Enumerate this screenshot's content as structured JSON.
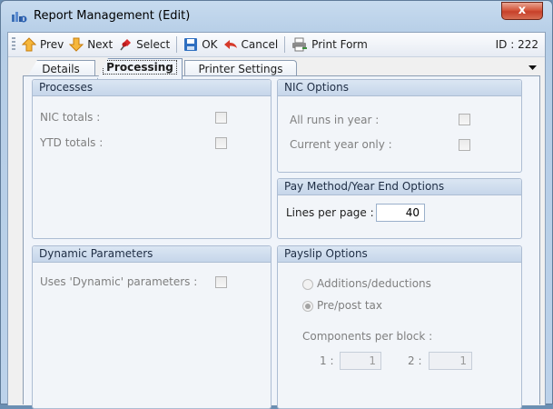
{
  "window": {
    "title": "Report Management (Edit)",
    "close_glyph": "x"
  },
  "toolbar": {
    "prev": "Prev",
    "next": "Next",
    "select": "Select",
    "ok": "OK",
    "cancel": "Cancel",
    "print_form": "Print Form",
    "record_id": "ID : 222"
  },
  "tabs": [
    {
      "label": "Details",
      "active": false
    },
    {
      "label": "Processing",
      "active": true
    },
    {
      "label": "Printer Settings",
      "active": false
    }
  ],
  "processes": {
    "title": "Processes",
    "nic_totals": {
      "label": "NIC totals :",
      "checked": false
    },
    "ytd_totals": {
      "label": "YTD totals :",
      "checked": false
    }
  },
  "nic_options": {
    "title": "NIC Options",
    "all_runs": {
      "label": "All runs in year :",
      "checked": false
    },
    "current_year": {
      "label": "Current year only :",
      "checked": false
    }
  },
  "pay_method": {
    "title": "Pay Method/Year End Options",
    "lines_label": "Lines per page :",
    "lines_value": "40"
  },
  "dynamic": {
    "title": "Dynamic Parameters",
    "uses_dynamic": {
      "label": "Uses 'Dynamic' parameters :",
      "checked": false
    }
  },
  "payslip": {
    "title": "Payslip Options",
    "additions_label": "Additions/deductions",
    "prepost_label": "Pre/post tax",
    "selected": "Pre/post tax",
    "components_label": "Components per block :",
    "comp1_label": "1 :",
    "comp1_value": "1",
    "comp2_label": "2 :",
    "comp2_value": "1"
  },
  "colors": {
    "accent": "#c6d6ea",
    "frame": "#b5cde6",
    "close": "#c7402a"
  }
}
